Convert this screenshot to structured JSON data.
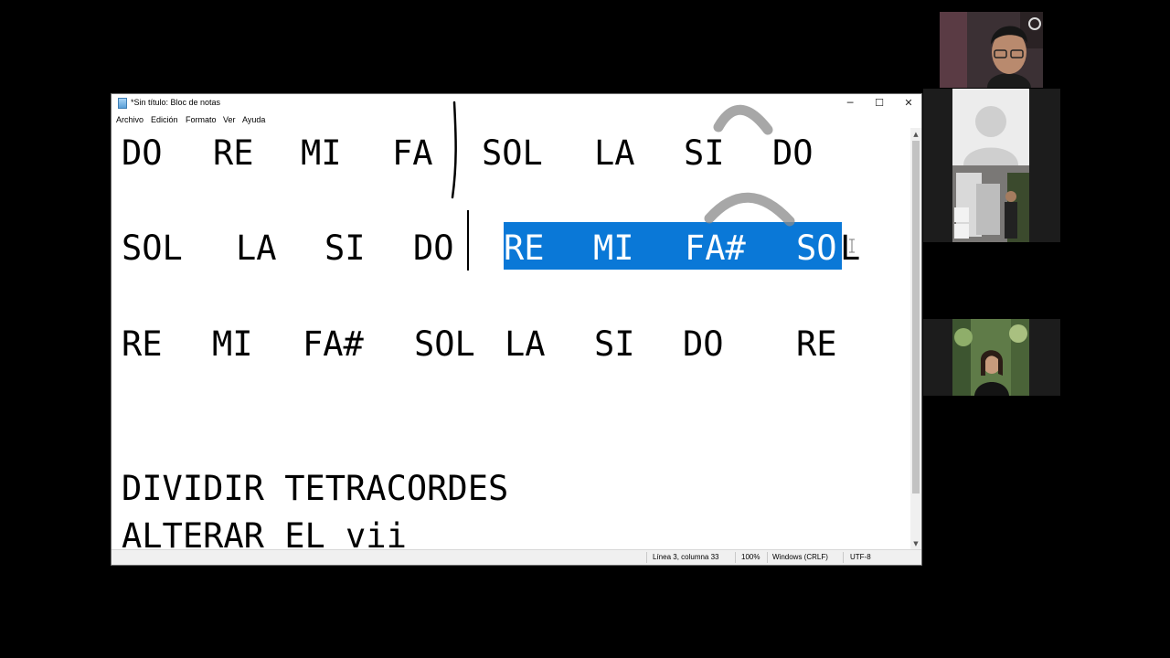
{
  "window": {
    "title": "*Sin título: Bloc de notas",
    "controls": {
      "minimize": "─",
      "maximize": "☐",
      "close": "✕"
    }
  },
  "menu": [
    "Archivo",
    "Edición",
    "Formato",
    "Ver",
    "Ayuda"
  ],
  "editor": {
    "line1": [
      "DO",
      "RE",
      "MI",
      "FA",
      "SOL",
      "LA",
      "SI",
      "DO"
    ],
    "line2": [
      "SOL",
      "LA",
      "SI",
      "DO",
      "RE",
      "MI",
      "FA#",
      "SO",
      "L"
    ],
    "line3": [
      "RE",
      "MI",
      "FA#",
      "SOL",
      "LA",
      "SI",
      "DO",
      "RE"
    ],
    "line4": "DIVIDIR TETRACORDES",
    "line5": "ALTERAR EL vii",
    "selection_text": "RE  MI  FA#  SO"
  },
  "status": {
    "position": "Línea 3, columna 33",
    "zoom": "100%",
    "line_ending": "Windows (CRLF)",
    "encoding": "UTF-8"
  },
  "colors": {
    "selection": "#0a78d7",
    "annotation_stroke": "#000000",
    "annotation_arc": "#8a8a8a"
  },
  "participants": [
    {
      "icon": "person-webcam"
    },
    {
      "icon": "avatar-placeholder"
    },
    {
      "icon": "person-webcam"
    },
    {
      "icon": "person-webcam"
    }
  ]
}
